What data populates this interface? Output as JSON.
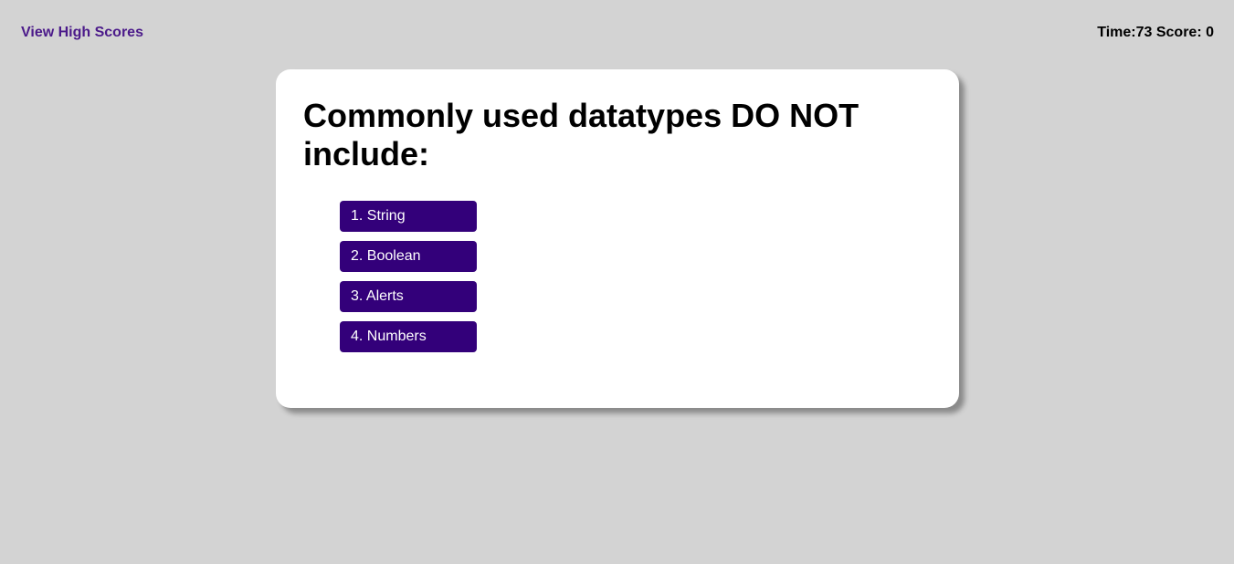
{
  "header": {
    "high_scores_label": "View High Scores",
    "status_text": "Time:73 Score: 0"
  },
  "quiz": {
    "question": "Commonly used datatypes DO NOT include:",
    "answers": [
      {
        "label": "1. String"
      },
      {
        "label": "2. Boolean"
      },
      {
        "label": "3. Alerts"
      },
      {
        "label": "4. Numbers"
      }
    ]
  },
  "colors": {
    "background": "#d3d3d3",
    "link": "#4b1a8a",
    "button": "#33007a",
    "card": "#ffffff"
  }
}
